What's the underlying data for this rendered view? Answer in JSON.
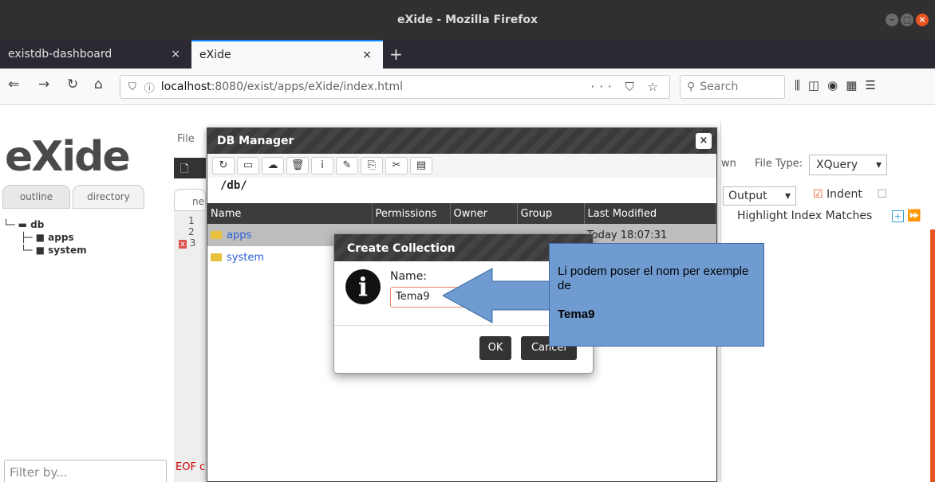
{
  "window": {
    "title": "eXide - Mozilla Firefox"
  },
  "tabs": [
    {
      "label": "existdb-dashboard",
      "close": "×"
    },
    {
      "label": "eXide",
      "close": "×"
    }
  ],
  "new_tab": "+",
  "nav": {
    "url_host": "localhost",
    "url_path": ":8080/exist/apps/eXide/index.html",
    "url_actions": "··· ⛉ ☆",
    "search_placeholder": "Search"
  },
  "sidebar": {
    "logo": "eXide",
    "tabs": [
      "outline",
      "directory"
    ],
    "tree": [
      "db",
      "apps",
      "system"
    ],
    "filter_placeholder": "Filter by..."
  },
  "editor": {
    "file_menu": "File",
    "new_btn": "N",
    "tab_label": "ne",
    "lines": [
      "1",
      "2",
      "3"
    ],
    "eof": "EOF c"
  },
  "right_panel": {
    "dropdown_tail": "wn",
    "file_type_label": "File Type:",
    "file_type_value": "XQuery",
    "output_value": "Output",
    "indent_label": "Indent",
    "highlight_label": "Highlight Index Matches"
  },
  "db_manager": {
    "title": "DB Manager",
    "path": "/db/",
    "columns": [
      "Name",
      "Permissions",
      "Owner",
      "Group",
      "Last Modified"
    ],
    "rows": [
      {
        "name": "apps",
        "last_modified": "Today 18:07:31"
      },
      {
        "name": "system",
        "last_modified": ""
      }
    ]
  },
  "create_collection": {
    "title": "Create Collection",
    "name_label": "Name:",
    "name_value": "Tema9",
    "ok": "OK",
    "cancel": "Cancel"
  },
  "callout": {
    "text": "Li podem poser el nom per exemple de",
    "bold": "Tema9",
    "color": "#6f9bd1"
  }
}
